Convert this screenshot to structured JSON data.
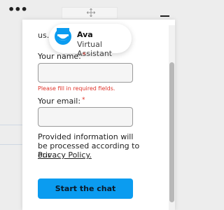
{
  "window": {
    "menu_glyph": "•••",
    "drag_icon": "move-icon",
    "minimize_icon": "minimize-icon"
  },
  "assistant": {
    "name": "Ava",
    "role": "Virtual Assistant",
    "logo_icon": "ava-logo-icon",
    "brand_color": "#0b9cf0"
  },
  "form": {
    "truncated_text": "us.",
    "name_label": "Your name:",
    "name_value": "",
    "required_mark": "*",
    "name_error": "Please fill in required fields.",
    "email_label": "Your email:",
    "email_value": "",
    "notice": "Provided information will be processed according to our",
    "privacy_link": "Privacy Policy.",
    "submit_label": "Start the chat",
    "error_color": "#e0332a"
  }
}
